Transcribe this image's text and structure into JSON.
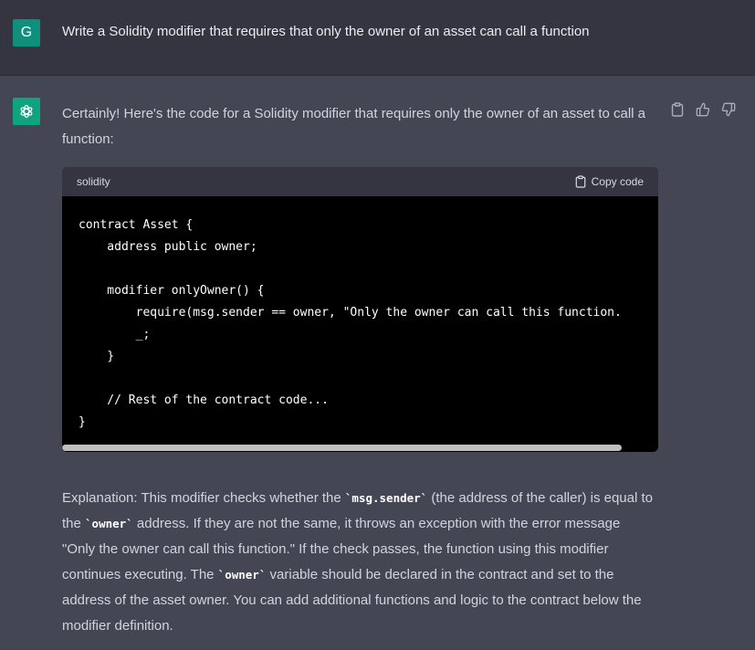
{
  "user_message": {
    "avatar_letter": "G",
    "avatar_color": "#0f8f7e",
    "text": "Write a Solidity modifier that requires that only the owner of an asset can call a function"
  },
  "assistant_message": {
    "avatar_color": "#10a37f",
    "avatar_icon": "openai-logo-icon",
    "intro": "Certainly! Here's the code for a Solidity modifier that requires only the owner of an asset to call a function:",
    "actions": [
      "clipboard-icon",
      "thumbs-up-icon",
      "thumbs-down-icon"
    ],
    "code_block": {
      "language": "solidity",
      "copy_label": "Copy code",
      "lines": [
        "contract Asset {",
        "    address public owner;",
        "",
        "    modifier onlyOwner() {",
        "        require(msg.sender == owner, \"Only the owner can call this function.",
        "        _;",
        "    }",
        "",
        "    // Rest of the contract code...",
        "}"
      ]
    },
    "explanation": {
      "p1": "Explanation: This modifier checks whether the ",
      "c1": "`msg.sender`",
      "p2": " (the address of the caller) is equal to the ",
      "c2": "`owner`",
      "p3": " address. If they are not the same, it throws an exception with the error message \"Only the owner can call this function.\" If the check passes, the function using this modifier continues executing. The ",
      "c3": "`owner`",
      "p4": " variable should be declared in the contract and set to the address of the asset owner. You can add additional functions and logic to the contract below the modifier definition."
    }
  }
}
